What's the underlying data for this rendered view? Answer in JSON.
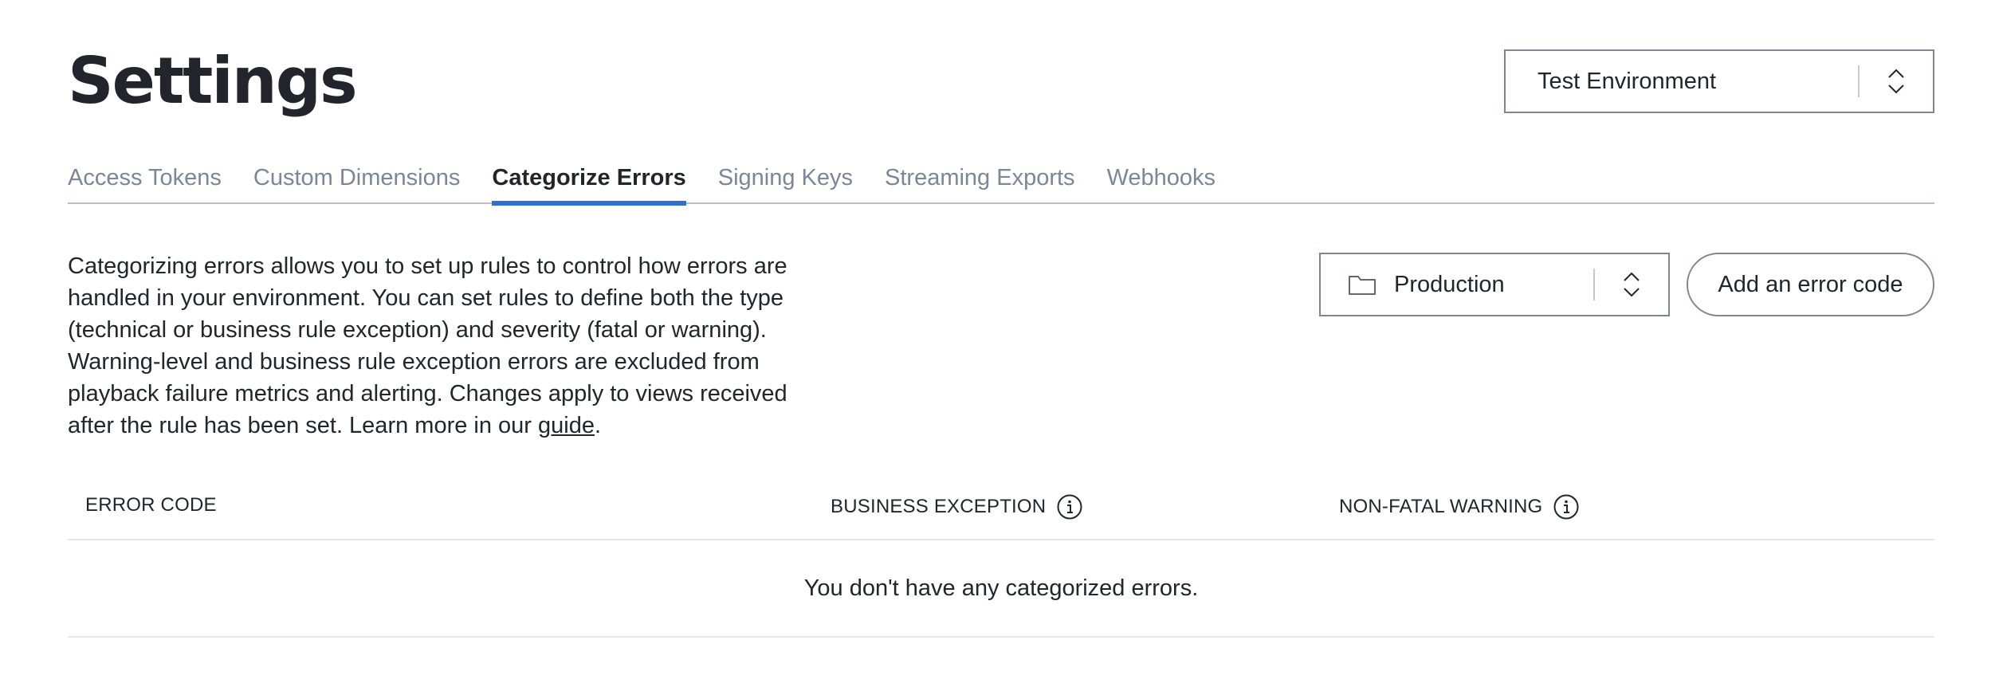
{
  "header": {
    "title": "Settings",
    "environment_select": {
      "value": "Test Environment",
      "icon": "chevron-up-down-icon"
    }
  },
  "tabs": [
    {
      "label": "Access Tokens",
      "active": false
    },
    {
      "label": "Custom Dimensions",
      "active": false
    },
    {
      "label": "Categorize Errors",
      "active": true
    },
    {
      "label": "Signing Keys",
      "active": false
    },
    {
      "label": "Streaming Exports",
      "active": false
    },
    {
      "label": "Webhooks",
      "active": false
    }
  ],
  "description": {
    "text": "Categorizing errors allows you to set up rules to control how errors are handled in your environment. You can set rules to define both the type (technical or business rule exception) and severity (fatal or warning). Warning-level and business rule exception errors are excluded from playback failure metrics and alerting. Changes apply to views received after the rule has been set. Learn more in our ",
    "link_text": "guide",
    "suffix": "."
  },
  "project_select": {
    "value": "Production",
    "icon": "folder-icon"
  },
  "add_button": {
    "label": "Add an error code"
  },
  "table": {
    "columns": [
      {
        "label": "ERROR CODE",
        "info_icon": false
      },
      {
        "label": "BUSINESS EXCEPTION",
        "info_icon": true
      },
      {
        "label": "NON-FATAL WARNING",
        "info_icon": true
      }
    ],
    "empty_message": "You don't have any categorized errors."
  },
  "colors": {
    "accent": "#2f6fd0",
    "text": "#22252b",
    "muted_tab": "#7b8696",
    "border": "#7d8794"
  }
}
